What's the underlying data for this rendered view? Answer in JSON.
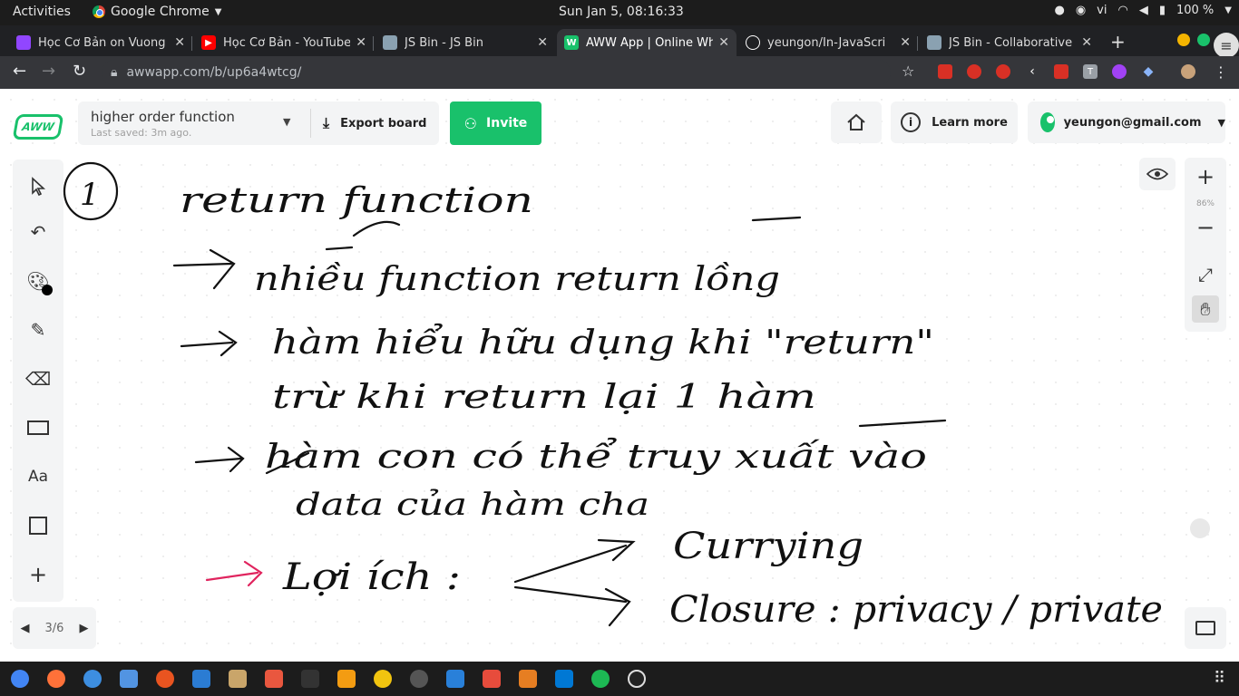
{
  "topbar": {
    "activities": "Activities",
    "app_name": "Google Chrome",
    "clock": "Sun Jan  5, 08:16:33",
    "language": "vi",
    "battery": "100 %"
  },
  "tabs": [
    {
      "title": "Học Cơ Bản on Vuong",
      "favicon_color": "#9146ff",
      "favicon": "twitch-icon"
    },
    {
      "title": "Học Cơ Bản - YouTube",
      "favicon_color": "#ff0000",
      "favicon": "youtube-icon"
    },
    {
      "title": "JS Bin - JS Bin",
      "favicon_color": "#8aa1b1",
      "favicon": "jsbin-icon"
    },
    {
      "title": "AWW App | Online Wh",
      "favicon_color": "#19c16b",
      "favicon": "aww-icon"
    },
    {
      "title": "yeungon/In-JavaScri",
      "favicon_color": "#ffffff",
      "favicon": "github-icon"
    },
    {
      "title": "JS Bin - Collaborative",
      "favicon_color": "#8aa1b1",
      "favicon": "jsbin-icon"
    }
  ],
  "address": {
    "url": "awwapp.com/b/up6a4wtcg/"
  },
  "app": {
    "logo_text": "AWW",
    "board_title": "higher order function",
    "last_saved": "Last saved: 3m ago.",
    "export_label": "Export board",
    "invite_label": "Invite",
    "learn_more_label": "Learn more",
    "account_email": "yeungon@gmail.com",
    "zoom_level": "86%",
    "page_indicator": "3/6",
    "text_tool_label": "Aa",
    "accent_color": "#19c16b"
  },
  "handwriting": {
    "number": "1",
    "line1": "return function",
    "line2": "nhiều function return lồng",
    "line3": "hàm hiểu hữu dụng khi \"return\"",
    "line4": "trừ khi return lại 1 hàm",
    "line5": "hàm con có thể truy xuất vào",
    "line6": "data của hàm cha",
    "line7": "Lợi ích :",
    "line8a": "Currying",
    "line8b": "Closure : privacy / private"
  }
}
